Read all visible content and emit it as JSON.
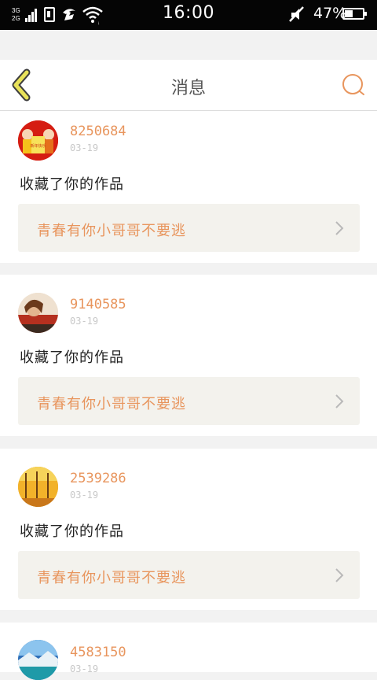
{
  "status_bar": {
    "network_top": "3G",
    "network_bottom": "2G",
    "time": "16:00",
    "battery_percent_text": "47%",
    "battery_level": 0.47,
    "icons": [
      "signal-icon",
      "sim-icon",
      "carrier-icon",
      "wifi-icon",
      "mute-icon",
      "battery-icon"
    ]
  },
  "header": {
    "title": "消息",
    "back_icon": "chevron-left-icon",
    "search_icon": "search-icon"
  },
  "colors": {
    "accent": "#e8955d",
    "back_arrow": "#e8e25a",
    "background": "#f2f2f2",
    "work_box": "#f3f2ed"
  },
  "messages": [
    {
      "user_id": "8250684",
      "date": "03-19",
      "action": "收藏了你的作品",
      "work_title": "青春有你小哥哥不要逃",
      "avatar_caption": "新年快乐"
    },
    {
      "user_id": "9140585",
      "date": "03-19",
      "action": "收藏了你的作品",
      "work_title": "青春有你小哥哥不要逃"
    },
    {
      "user_id": "2539286",
      "date": "03-19",
      "action": "收藏了你的作品",
      "work_title": "青春有你小哥哥不要逃"
    },
    {
      "user_id": "4583150",
      "date": "03-19"
    }
  ]
}
